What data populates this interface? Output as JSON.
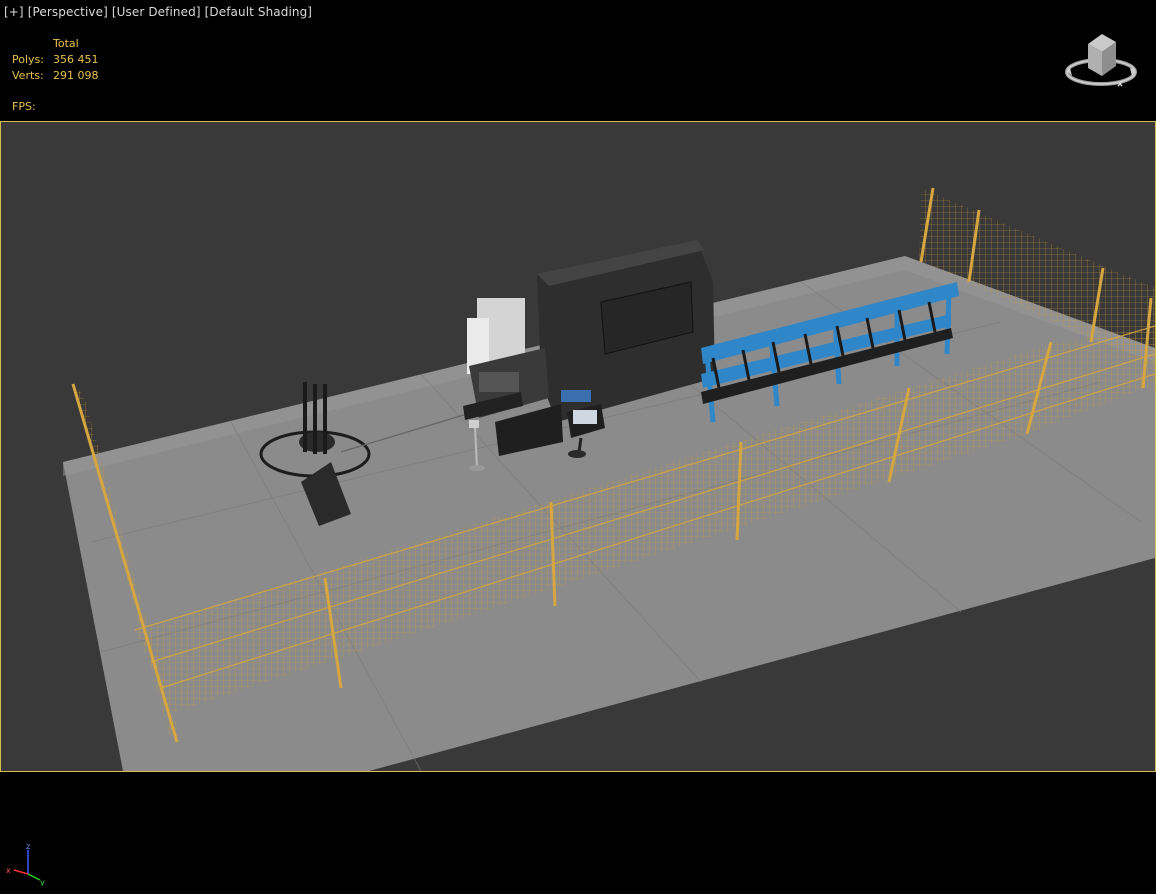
{
  "viewport_labels": {
    "menu": "[+]",
    "view": "[Perspective]",
    "camera": "[User Defined]",
    "shading": "[Default Shading]"
  },
  "stats": {
    "header": "Total",
    "polys_label": "Polys:",
    "polys_value": "356 451",
    "verts_label": "Verts:",
    "verts_value": "291 098",
    "fps_label": "FPS:"
  },
  "axis_labels": {
    "x": "x",
    "y": "y",
    "z": "z"
  },
  "colors": {
    "viewport_bg": "#393939",
    "active_border": "#d1c04a",
    "stats_text": "#e6c14c",
    "fence": "#c99a3a",
    "rack": "#2f86c9",
    "floor": "#8a8a8a"
  },
  "icons": {
    "viewcube": "viewcube-icon",
    "axis_tripod": "axis-tripod-icon"
  }
}
